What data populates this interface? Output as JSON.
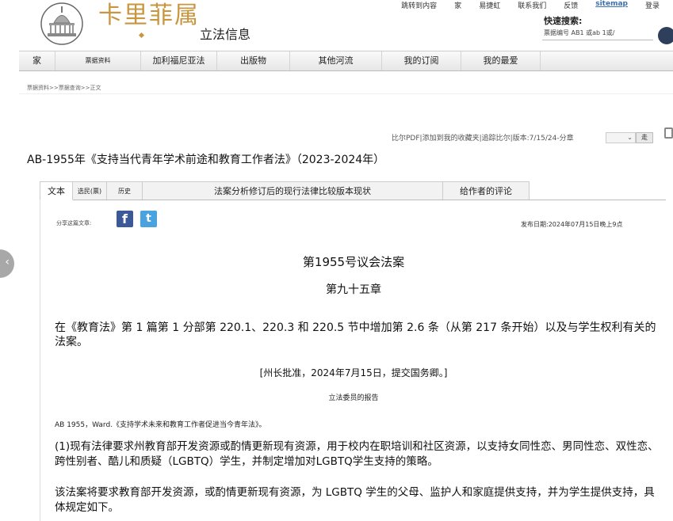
{
  "header": {
    "brand": "卡里菲属",
    "subtitle": "立法信息",
    "top_links": [
      "跳转到内容",
      "家",
      "易捷虹",
      "联系我们",
      "反馈",
      "sitemap",
      "登录"
    ],
    "quick_search_label": "快速搜索:",
    "quick_search_hint": "票据编号 AB1 或ab 1或/"
  },
  "nav": {
    "items": [
      "家",
      "票据资料",
      "加利福尼亚法",
      "出版物",
      "其他河流",
      "我的订阅",
      "我的最爱"
    ]
  },
  "breadcrumb": "票据资料>>票据查询>>正文",
  "toolbar": {
    "links": "比尔PDF|添加到我的收藏夹|追踪比尔|版本:7/15/24-分章",
    "go": "走"
  },
  "bill_title": "AB-1955年《支持当代青年学术前途和教育工作者法》（2023-2024年）",
  "tabs": [
    "文本",
    "选民(票)",
    "历史",
    "法案分析修订后的现行法律比较版本现状",
    "给作者的评论"
  ],
  "content": {
    "share_label": "分享这篇文章:",
    "fb_glyph": "f",
    "tw_glyph": "t",
    "publish_date": "发布日期:2024年07月15日晚上9点",
    "bill_heading": "第1955号议会法案",
    "chapter_heading": "第九十五章",
    "summary_title": "在《教育法》第 1 篇第 1 分部第 220.1、220.3 和 220.5 节中增加第 2.6 条（从第 217 条开始）以及与学生权利有关的法案。",
    "approval": "[州长批准，2024年7月15日，提交国务卿。]",
    "digest_label": "立法委员的报告",
    "ab_line": "AB 1955，Ward.《支持学术未来和教育工作者促进当今青年法》。",
    "para1": "(1)现有法律要求州教育部开发资源或酌情更新现有资源，用于校内在职培训和社区资源，以支持女同性恋、男同性恋、双性恋、跨性别者、酷儿和质疑（LGBTQ）学生，并制定增加对LGBTQ学生支持的策略。",
    "para2": "该法案将要求教育部开发资源，或酌情更新现有资源，为 LGBTQ 学生的父母、监护人和家庭提供支持，并为学生提供支持，具体规定如下。"
  },
  "side_button_glyph": "‹"
}
